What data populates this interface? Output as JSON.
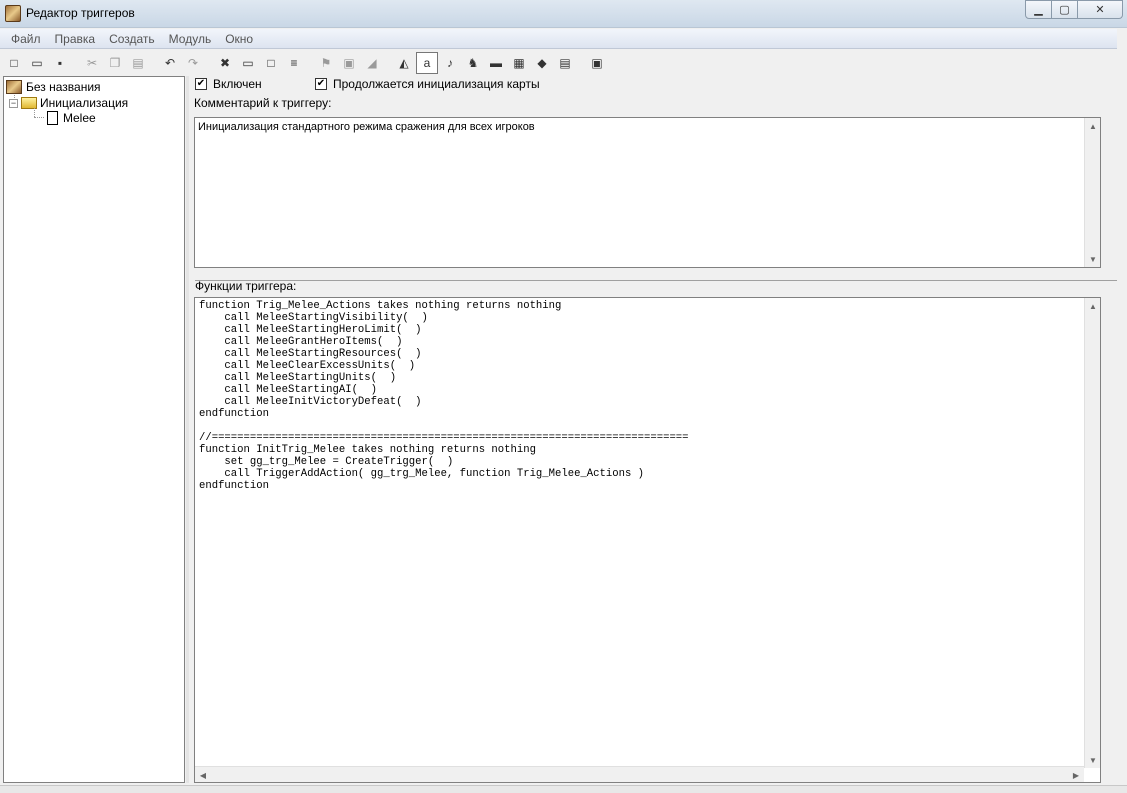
{
  "window": {
    "title": "Редактор триггеров"
  },
  "menu": [
    "Файл",
    "Правка",
    "Создать",
    "Модуль",
    "Окно"
  ],
  "toolbar": [
    {
      "icon": "new-file-icon",
      "glyph": "□"
    },
    {
      "icon": "open-folder-icon",
      "glyph": "▭"
    },
    {
      "icon": "save-icon",
      "glyph": "▪"
    },
    {
      "icon": "separator",
      "glyph": ""
    },
    {
      "icon": "cut-icon",
      "glyph": "✂",
      "disabled": true
    },
    {
      "icon": "copy-icon",
      "glyph": "❐",
      "disabled": true
    },
    {
      "icon": "paste-icon",
      "glyph": "▤",
      "disabled": true
    },
    {
      "icon": "separator",
      "glyph": ""
    },
    {
      "icon": "undo-icon",
      "glyph": "↶"
    },
    {
      "icon": "redo-icon",
      "glyph": "↷",
      "disabled": true
    },
    {
      "icon": "separator",
      "glyph": ""
    },
    {
      "icon": "delete-icon",
      "glyph": "✖"
    },
    {
      "icon": "new-category-icon",
      "glyph": "▭"
    },
    {
      "icon": "new-trigger-icon",
      "glyph": "□"
    },
    {
      "icon": "new-comment-icon",
      "glyph": "≡"
    },
    {
      "icon": "separator",
      "glyph": ""
    },
    {
      "icon": "new-event-icon",
      "glyph": "⚑",
      "disabled": true
    },
    {
      "icon": "new-condition-icon",
      "glyph": "▣",
      "disabled": true
    },
    {
      "icon": "new-action-icon",
      "glyph": "◢",
      "disabled": true
    },
    {
      "icon": "separator",
      "glyph": ""
    },
    {
      "icon": "terrain-editor-icon",
      "glyph": "◭"
    },
    {
      "icon": "trigger-editor-icon",
      "glyph": "a",
      "boxed": true
    },
    {
      "icon": "sound-editor-icon",
      "glyph": "♪"
    },
    {
      "icon": "unit-editor-icon",
      "glyph": "♞"
    },
    {
      "icon": "ai-editor-icon",
      "glyph": "▬"
    },
    {
      "icon": "object-editor-icon",
      "glyph": "▦"
    },
    {
      "icon": "campaign-editor-icon",
      "glyph": "◆"
    },
    {
      "icon": "import-manager-icon",
      "glyph": "▤"
    },
    {
      "icon": "separator",
      "glyph": ""
    },
    {
      "icon": "test-map-icon",
      "glyph": "▣"
    }
  ],
  "tree": {
    "root": "Без названия",
    "category": "Инициализация",
    "trigger": "Melee"
  },
  "options": {
    "enabled_label": "Включен",
    "map_init_label": "Продолжается инициализация карты"
  },
  "comment": {
    "label": "Комментарий к триггеру:",
    "text": "Инициализация стандартного режима сражения для всех игроков"
  },
  "functions": {
    "label": "Функции триггера:",
    "code": "function Trig_Melee_Actions takes nothing returns nothing\n    call MeleeStartingVisibility(  )\n    call MeleeStartingHeroLimit(  )\n    call MeleeGrantHeroItems(  )\n    call MeleeStartingResources(  )\n    call MeleeClearExcessUnits(  )\n    call MeleeStartingUnits(  )\n    call MeleeStartingAI(  )\n    call MeleeInitVictoryDefeat(  )\nendfunction\n\n//===========================================================================\nfunction InitTrig_Melee takes nothing returns nothing\n    set gg_trg_Melee = CreateTrigger(  )\n    call TriggerAddAction( gg_trg_Melee, function Trig_Melee_Actions )\nendfunction"
  }
}
